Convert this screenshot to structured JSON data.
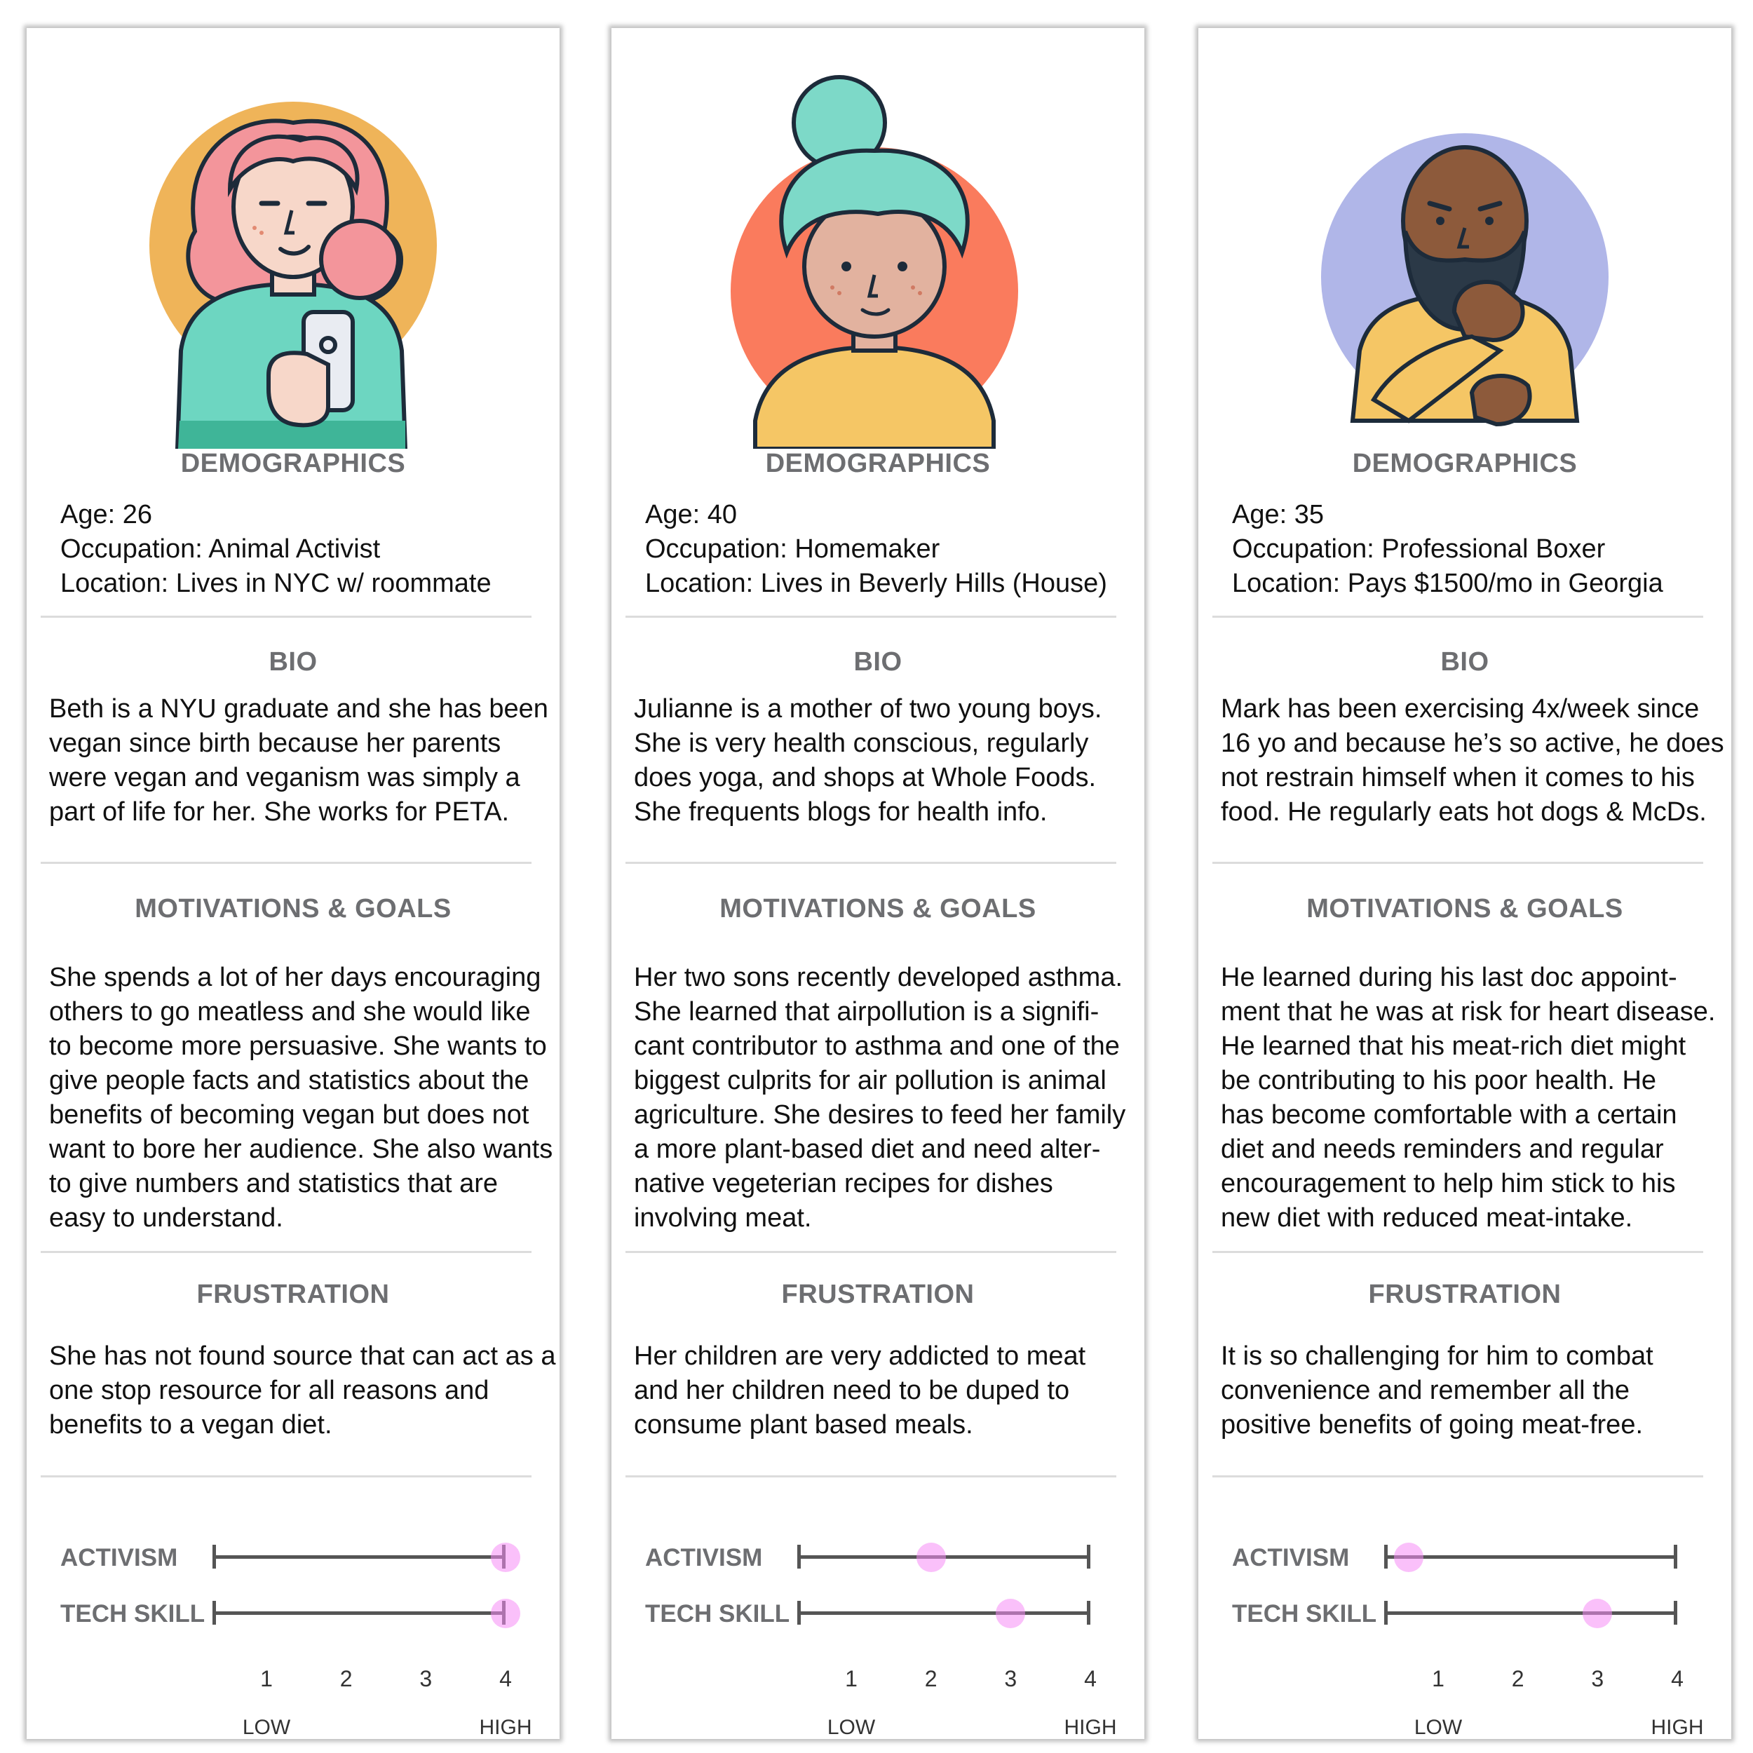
{
  "personas": [
    {
      "demographics_heading": "DEMOGRAPHICS",
      "age": "Age: 26",
      "occupation": "Occupation:  Animal Activist",
      "location": "Location:  Lives in NYC w/ roommate",
      "bio_heading": "BIO",
      "bio_lines": [
        "Beth is a NYU graduate and she has been",
        "vegan since birth because her parents",
        "were vegan and veganism was simply a",
        "part of life for her. She works for PETA."
      ],
      "motivations_heading": "MOTIVATIONS & GOALS",
      "motivation_lines": [
        "She spends a lot of her days encouraging",
        "others to go meatless and she would like",
        "to become more persuasive. She wants to",
        "give people facts and statistics about the",
        "benefits of becoming vegan but does not",
        "want to bore her audience. She also wants",
        "to give numbers and statistics that are",
        "easy to understand."
      ],
      "frustration_heading": "FRUSTRATION",
      "frustration_lines": [
        "She has not found source that can act as a",
        "one stop resource for all reasons and",
        "benefits to a vegan diet."
      ],
      "activism_label": "ACTIVISM",
      "tech_label": "TECH SKILL",
      "activism_value": 4,
      "tech_value": 4,
      "colors": {
        "circle": "#efb459",
        "hair": "#f3959b",
        "shirt": "#6dd6c1"
      }
    },
    {
      "demographics_heading": "DEMOGRAPHICS",
      "age": "Age: 40",
      "occupation": "Occupation:  Homemaker",
      "location": "Location:  Lives in Beverly Hills (House)",
      "bio_heading": "BIO",
      "bio_lines": [
        "Julianne is a mother of two young boys.",
        "She is very health conscious, regularly",
        "does yoga, and shops at Whole Foods.",
        "She frequents blogs for health info."
      ],
      "motivations_heading": "MOTIVATIONS & GOALS",
      "motivation_lines": [
        "Her two sons recently developed asthma.",
        "She learned that airpollution is a signifi-",
        "cant contributor to asthma and one of the",
        "biggest culprits for air pollution is animal",
        "agriculture.  She desires to feed her family",
        "a more plant-based diet and need alter-",
        "native vegeterian recipes for dishes",
        "involving meat."
      ],
      "frustration_heading": "FRUSTRATION",
      "frustration_lines": [
        "Her children are very addicted to meat",
        "and her children need to be duped to",
        "consume plant based meals."
      ],
      "activism_label": "ACTIVISM",
      "tech_label": "TECH SKILL",
      "activism_value": 2,
      "tech_value": 3,
      "colors": {
        "circle": "#fa7b5d",
        "hair": "#7dd9c8",
        "shirt": "#f5c665"
      }
    },
    {
      "demographics_heading": "DEMOGRAPHICS",
      "age": "Age: 35",
      "occupation": "Occupation:  Professional Boxer",
      "location": "Location:  Pays $1500/mo in Georgia",
      "bio_heading": "BIO",
      "bio_lines": [
        "Mark has been exercising 4x/week since",
        "16 yo and because he’s so active, he does",
        "not restrain himself when it comes to his",
        "food. He regularly eats hot dogs & McDs."
      ],
      "motivations_heading": "MOTIVATIONS & GOALS",
      "motivation_lines": [
        "He learned during his last doc appoint-",
        "ment that he  was at risk for heart disease.",
        "He learned that his meat-rich diet might",
        "be contributing to his poor health. He",
        "has become comfortable with a certain",
        "diet and needs reminders and regular",
        "encouragement to help him stick to his",
        "new diet with reduced meat-intake."
      ],
      "frustration_heading": "FRUSTRATION",
      "frustration_lines": [
        "It is so challenging for him to combat",
        "convenience and remember all the",
        "positive benefits of going meat-free."
      ],
      "activism_label": "ACTIVISM",
      "tech_label": "TECH SKILL",
      "activism_value": 1,
      "tech_value": 3,
      "colors": {
        "circle": "#b0b6e8",
        "skin": "#8d5a3b",
        "beard": "#2b3947",
        "shirt": "#f5c665"
      }
    }
  ],
  "scale": {
    "ticks": [
      "1",
      "2",
      "3",
      "4"
    ],
    "low_label": "LOW",
    "high_label": "HIGH",
    "dot_color": "#f68cf6"
  }
}
